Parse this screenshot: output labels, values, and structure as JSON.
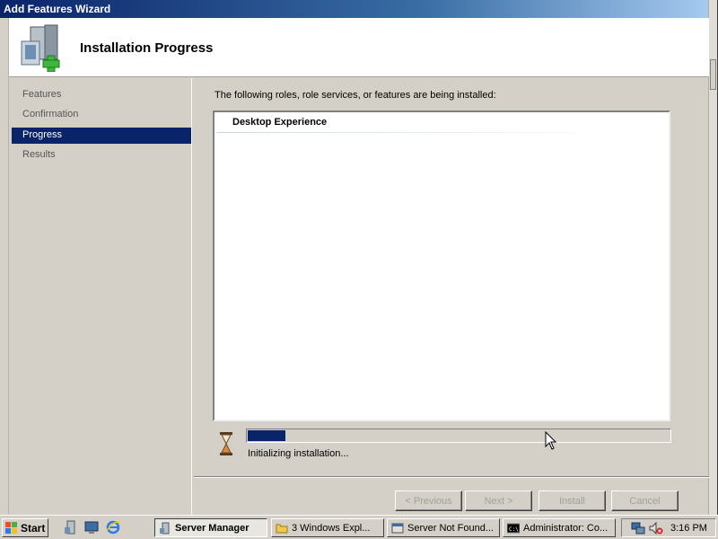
{
  "window": {
    "title": "Add Features Wizard",
    "header_title": "Installation Progress"
  },
  "nav": {
    "items": [
      {
        "label": "Features",
        "active": false
      },
      {
        "label": "Confirmation",
        "active": false
      },
      {
        "label": "Progress",
        "active": true
      },
      {
        "label": "Results",
        "active": false
      }
    ]
  },
  "content": {
    "intro": "The following roles, role services, or features are being installed:",
    "list_items": [
      "Desktop Experience"
    ],
    "progress_fraction": 0.09,
    "status_text": "Initializing installation..."
  },
  "buttons": {
    "previous": "< Previous",
    "next": "Next >",
    "install": "Install",
    "cancel": "Cancel"
  },
  "taskbar": {
    "start": "Start",
    "tasks": [
      {
        "label": "Server Manager",
        "icon": "server-manager-icon",
        "active": true
      },
      {
        "label": "3 Windows Expl...",
        "icon": "folder-icon",
        "active": false
      },
      {
        "label": "Server Not Found...",
        "icon": "browser-icon",
        "active": false
      },
      {
        "label": "Administrator: Co...",
        "icon": "cmd-icon",
        "active": false
      }
    ],
    "clock": "3:16 PM"
  },
  "colors": {
    "selection": "#0a246a",
    "face": "#d4d0c8"
  }
}
